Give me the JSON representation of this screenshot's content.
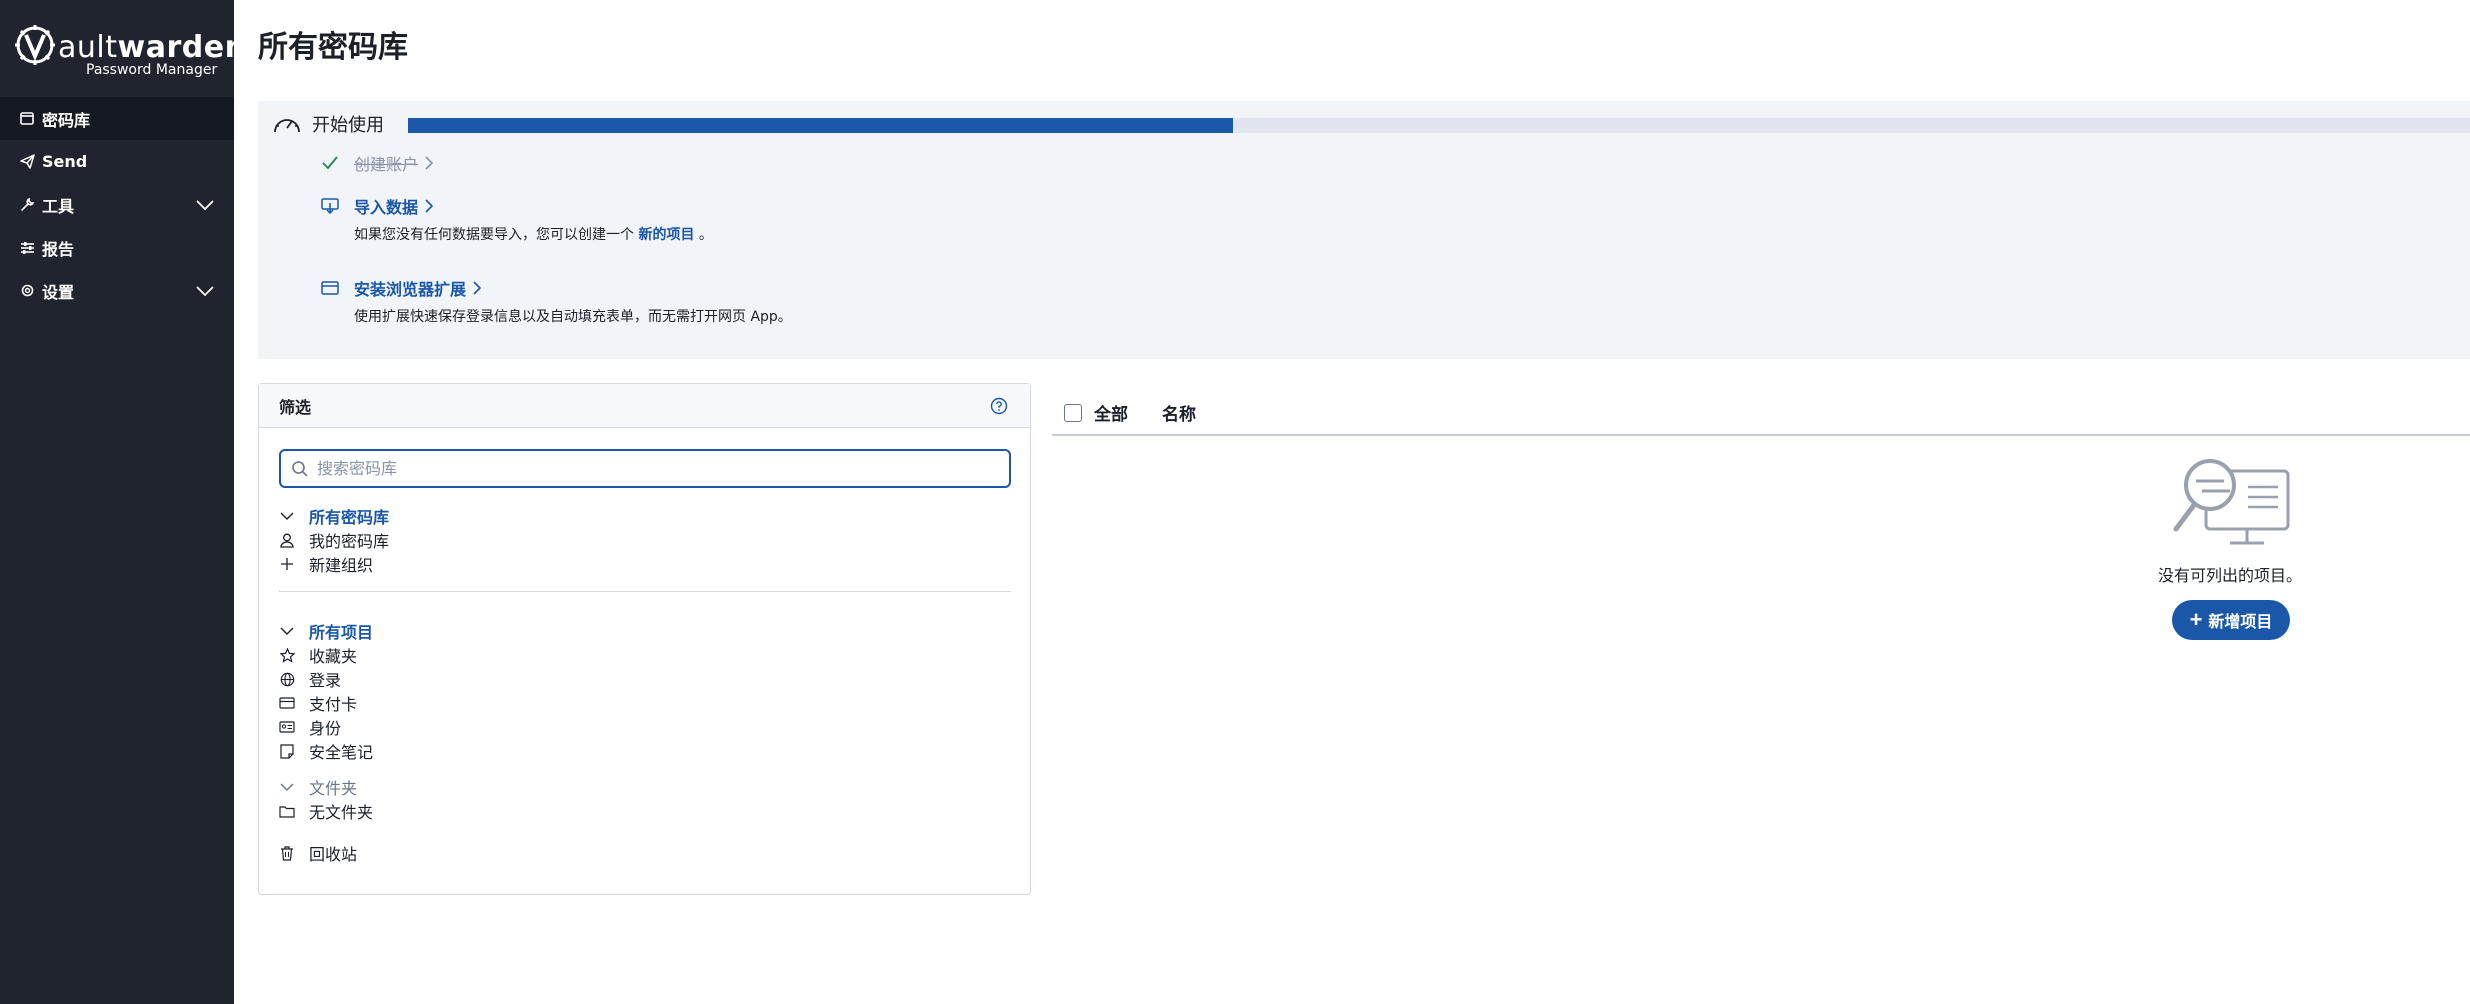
{
  "brand": {
    "name_light": "V",
    "name_rest": "ault",
    "name_bold": "warden",
    "tagline": "Password Manager"
  },
  "nav": {
    "items": [
      {
        "label": "密码库",
        "icon": "vault-icon",
        "active": true
      },
      {
        "label": "Send",
        "icon": "send-icon"
      },
      {
        "label": "工具",
        "icon": "wrench-icon",
        "expandable": true
      },
      {
        "label": "报告",
        "icon": "sliders-icon"
      },
      {
        "label": "设置",
        "icon": "gear-icon",
        "expandable": true
      }
    ]
  },
  "page": {
    "title": "所有密码库"
  },
  "onboarding": {
    "title": "开始使用",
    "progress": 0.4,
    "tasks": [
      {
        "label": "创建账户",
        "done": true,
        "icon": "check-icon"
      },
      {
        "label": "导入数据",
        "icon": "import-icon",
        "desc_before": "如果您没有任何数据要导入，您可以创建一个",
        "desc_link": "新的项目",
        "desc_after": "。"
      },
      {
        "label": "安装浏览器扩展",
        "icon": "browser-icon",
        "desc": "使用扩展快速保存登录信息以及自动填充表单，而无需打开网页 App。"
      }
    ]
  },
  "filter": {
    "title": "筛选",
    "search_placeholder": "搜索密码库",
    "vaults": {
      "header": "所有密码库",
      "items": [
        "我的密码库",
        "新建组织"
      ]
    },
    "types": {
      "header": "所有项目",
      "items": [
        "收藏夹",
        "登录",
        "支付卡",
        "身份",
        "安全笔记"
      ]
    },
    "folders": {
      "header": "文件夹",
      "items": [
        "无文件夹"
      ]
    },
    "trash": "回收站"
  },
  "table": {
    "col_all": "全部",
    "col_name": "名称"
  },
  "empty": {
    "text": "没有可列出的项目。",
    "button": "新增项目"
  },
  "colors": {
    "sidebar": "#1f242e",
    "accent": "#1a57a8",
    "panel": "#f1f4f8"
  }
}
